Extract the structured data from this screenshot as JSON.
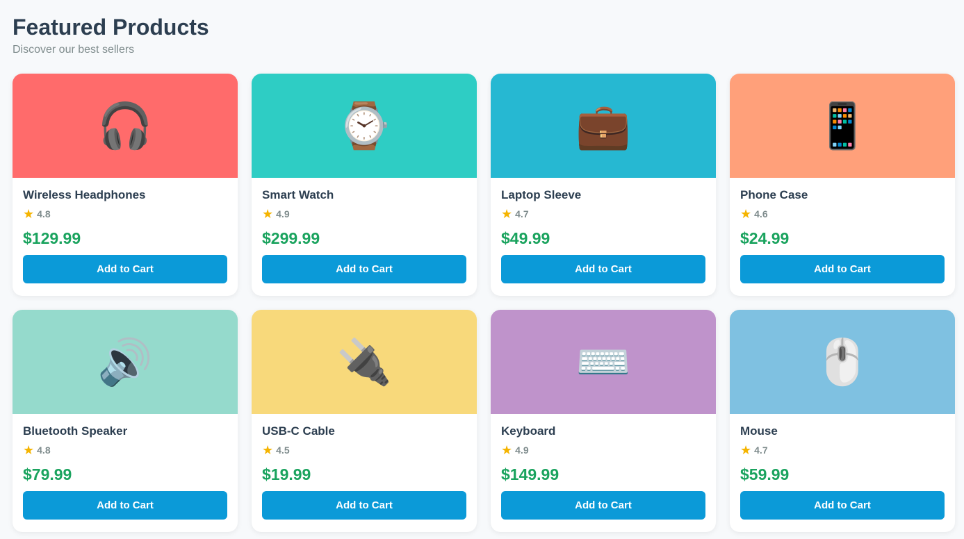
{
  "header": {
    "title": "Featured Products",
    "subtitle": "Discover our best sellers"
  },
  "products": [
    {
      "name": "Wireless Headphones",
      "rating": "4.8",
      "price": "$129.99",
      "button_label": "Add to Cart",
      "icon": "🎧",
      "icon_name": "headphones-icon",
      "bg_color": "#ff6b6b"
    },
    {
      "name": "Smart Watch",
      "rating": "4.9",
      "price": "$299.99",
      "button_label": "Add to Cart",
      "icon": "⌚",
      "icon_name": "watch-icon",
      "bg_color": "#2ecdc4"
    },
    {
      "name": "Laptop Sleeve",
      "rating": "4.7",
      "price": "$49.99",
      "button_label": "Add to Cart",
      "icon": "💼",
      "icon_name": "briefcase-icon",
      "bg_color": "#26b8d2"
    },
    {
      "name": "Phone Case",
      "rating": "4.6",
      "price": "$24.99",
      "button_label": "Add to Cart",
      "icon": "📱",
      "icon_name": "phone-icon",
      "bg_color": "#ffa07a"
    },
    {
      "name": "Bluetooth Speaker",
      "rating": "4.8",
      "price": "$79.99",
      "button_label": "Add to Cart",
      "icon": "🔊",
      "icon_name": "speaker-icon",
      "bg_color": "#95dacc"
    },
    {
      "name": "USB-C Cable",
      "rating": "4.5",
      "price": "$19.99",
      "button_label": "Add to Cart",
      "icon": "🔌",
      "icon_name": "plug-icon",
      "bg_color": "#f8d97b"
    },
    {
      "name": "Keyboard",
      "rating": "4.9",
      "price": "$149.99",
      "button_label": "Add to Cart",
      "icon": "⌨️",
      "icon_name": "keyboard-icon",
      "bg_color": "#bf93cb"
    },
    {
      "name": "Mouse",
      "rating": "4.7",
      "price": "$59.99",
      "button_label": "Add to Cart",
      "icon": "🖱️",
      "icon_name": "mouse-icon",
      "bg_color": "#7fc1e1"
    }
  ],
  "colors": {
    "price": "#1aa35e",
    "button": "#0b9ad8",
    "star": "#f5b400",
    "background": "#f7f9fb"
  },
  "icons": {
    "star": "★"
  }
}
